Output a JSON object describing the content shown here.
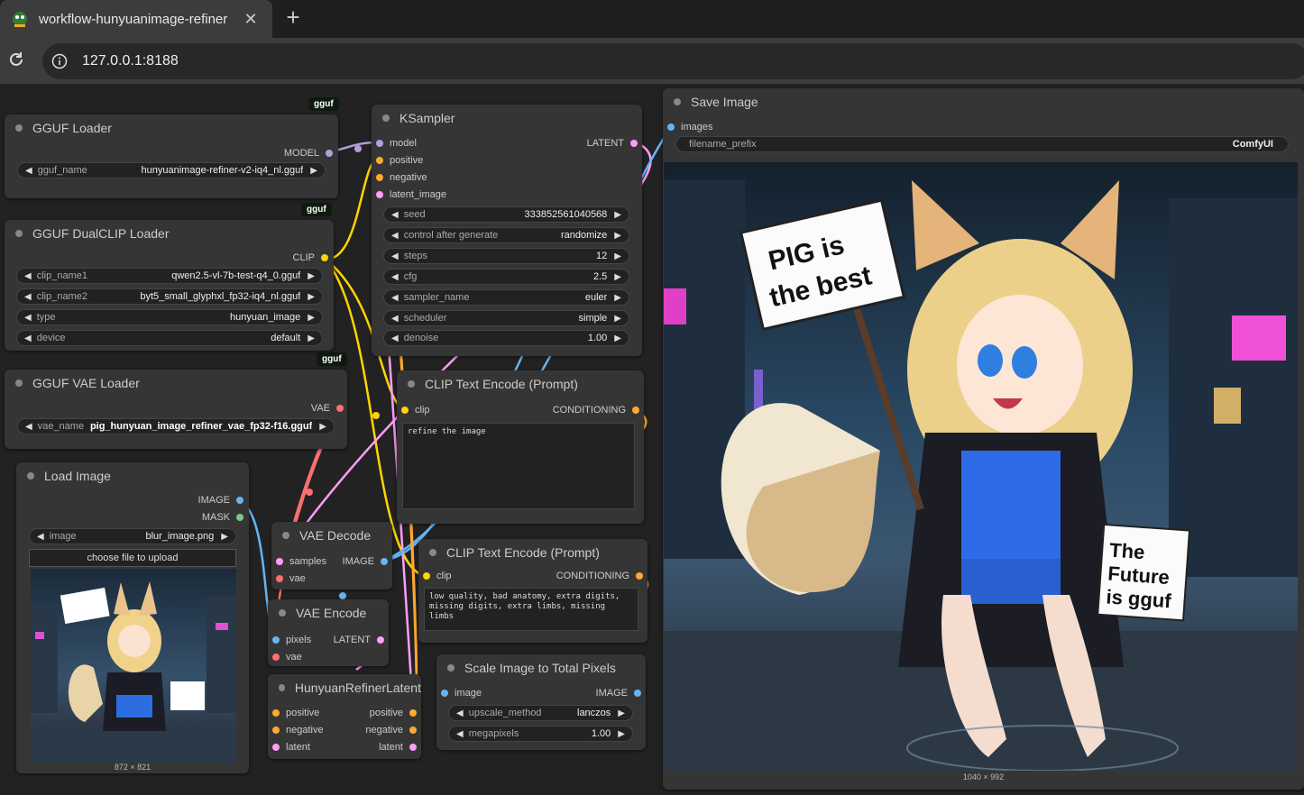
{
  "browser": {
    "tab_title": "workflow-hunyuanimage-refiner",
    "url": "127.0.0.1:8188",
    "new_tab": "+",
    "close": "✕"
  },
  "badges": {
    "gguf1": "gguf",
    "gguf2": "gguf",
    "gguf3": "gguf"
  },
  "nodes": {
    "gguf_loader": {
      "title": "GGUF Loader",
      "out_model": "MODEL",
      "w_label": "gguf_name",
      "w_value": "hunyuanimage-refiner-v2-iq4_nl.gguf"
    },
    "dualclip": {
      "title": "GGUF DualCLIP Loader",
      "out_clip": "CLIP",
      "widgets": [
        {
          "label": "clip_name1",
          "value": "qwen2.5-vl-7b-test-q4_0.gguf"
        },
        {
          "label": "clip_name2",
          "value": "byt5_small_glyphxl_fp32-iq4_nl.gguf"
        },
        {
          "label": "type",
          "value": "hunyuan_image"
        },
        {
          "label": "device",
          "value": "default"
        }
      ]
    },
    "vae_loader": {
      "title": "GGUF VAE Loader",
      "out_vae": "VAE",
      "w_label": "vae_name",
      "w_value": "pig_hunyuan_image_refiner_vae_fp32-f16.gguf"
    },
    "load_image": {
      "title": "Load Image",
      "out_image": "IMAGE",
      "out_mask": "MASK",
      "w_label": "image",
      "w_value": "blur_image.png",
      "button": "choose file to upload",
      "dims": "872 × 821"
    },
    "ksampler": {
      "title": "KSampler",
      "in_model": "model",
      "in_positive": "positive",
      "in_negative": "negative",
      "in_latent": "latent_image",
      "out_latent": "LATENT",
      "widgets": [
        {
          "label": "seed",
          "value": "333852561040568"
        },
        {
          "label": "control after generate",
          "value": "randomize"
        },
        {
          "label": "steps",
          "value": "12"
        },
        {
          "label": "cfg",
          "value": "2.5"
        },
        {
          "label": "sampler_name",
          "value": "euler"
        },
        {
          "label": "scheduler",
          "value": "simple"
        },
        {
          "label": "denoise",
          "value": "1.00"
        }
      ]
    },
    "clip_pos": {
      "title": "CLIP Text Encode (Prompt)",
      "in_clip": "clip",
      "out_cond": "CONDITIONING",
      "text": "refine the image"
    },
    "clip_neg": {
      "title": "CLIP Text Encode (Prompt)",
      "in_clip": "clip",
      "out_cond": "CONDITIONING",
      "text": "low quality, bad anatomy, extra digits, missing digits, extra limbs, missing limbs"
    },
    "vae_decode": {
      "title": "VAE Decode",
      "in_samples": "samples",
      "in_vae": "vae",
      "out_image": "IMAGE"
    },
    "vae_encode": {
      "title": "VAE Encode",
      "in_pixels": "pixels",
      "in_vae": "vae",
      "out_latent": "LATENT"
    },
    "refiner_latent": {
      "title": "HunyuanRefinerLatent",
      "in_positive": "positive",
      "in_negative": "negative",
      "in_latent": "latent",
      "out_positive": "positive",
      "out_negative": "negative",
      "out_latent": "latent"
    },
    "scale_image": {
      "title": "Scale Image to Total Pixels",
      "in_image": "image",
      "out_image": "IMAGE",
      "widgets": [
        {
          "label": "upscale_method",
          "value": "lanczos"
        },
        {
          "label": "megapixels",
          "value": "1.00"
        }
      ]
    },
    "save_image": {
      "title": "Save Image",
      "in_images": "images",
      "w_label": "filename_prefix",
      "w_value": "ComfyUI",
      "dims": "1040 × 992"
    }
  },
  "picture_text": {
    "sign1": "PIG is the best",
    "sign2": "The Future is gguf"
  },
  "colors": {
    "model": "#b39ddb",
    "clip": "#ffd500",
    "vae": "#ff6e6e",
    "conditioning": "#ffa931",
    "latent": "#ff9cf9",
    "image": "#64b5f6",
    "mask": "#81c784"
  }
}
